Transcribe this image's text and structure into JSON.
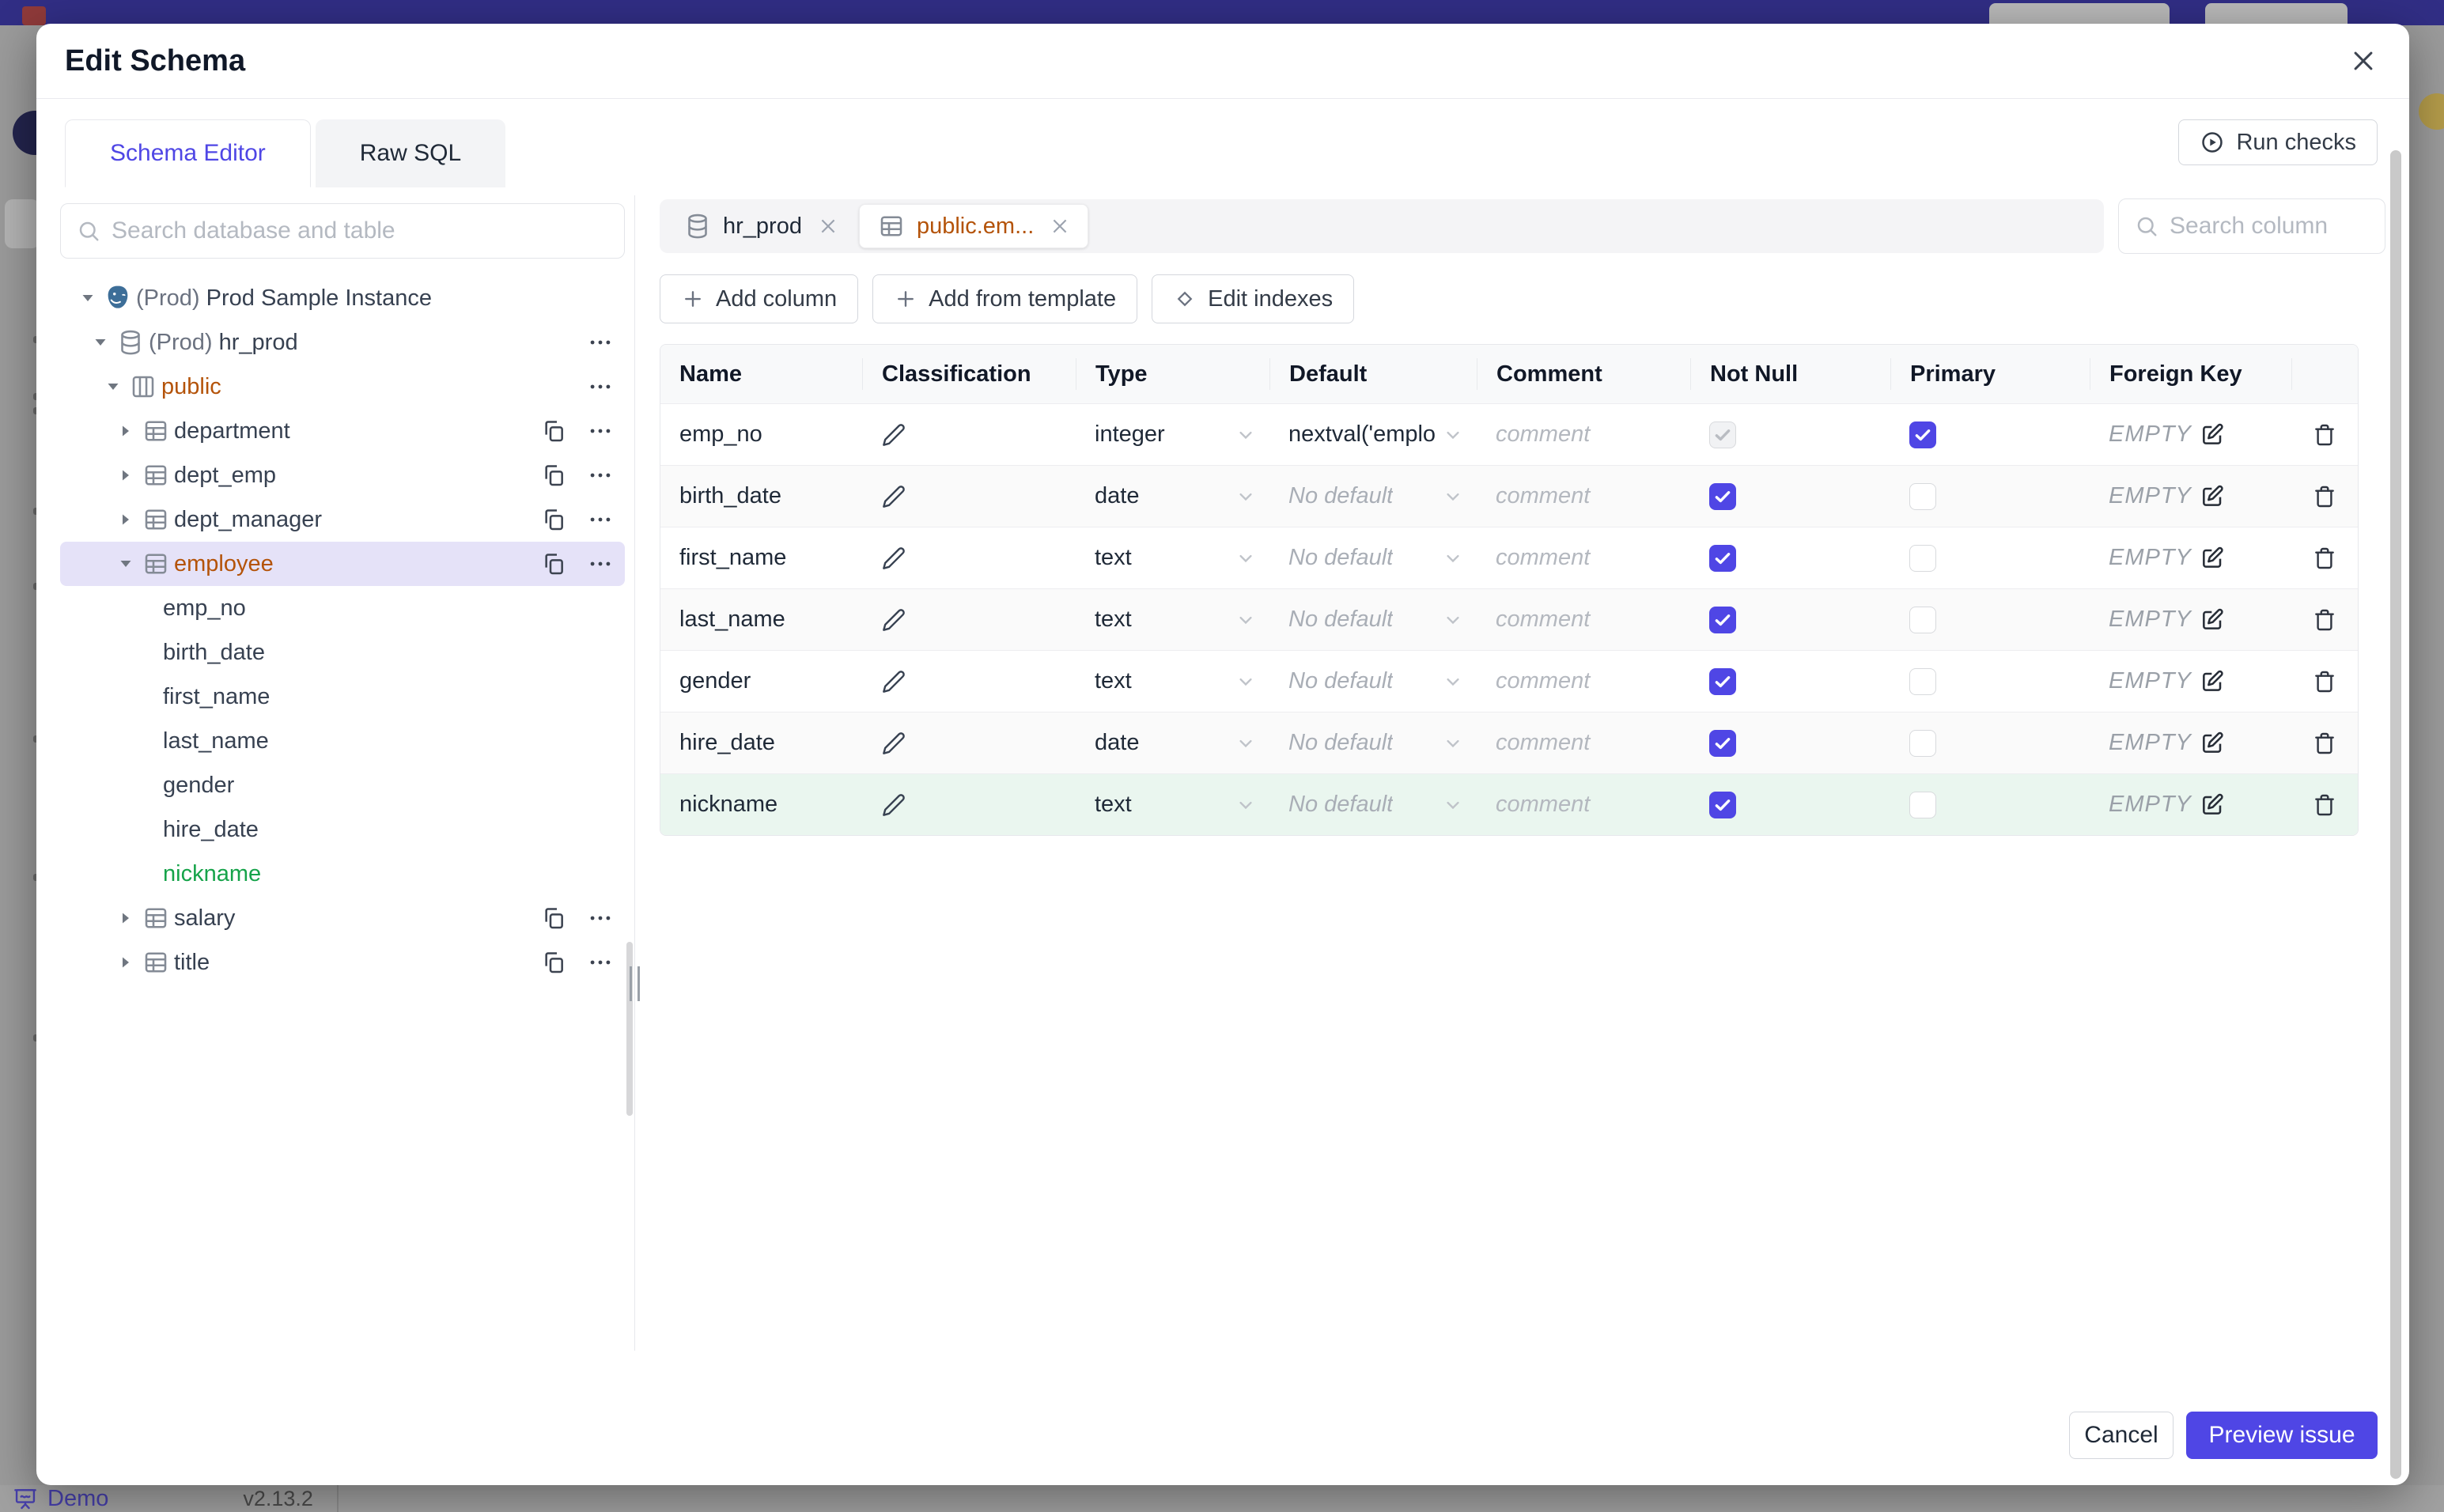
{
  "backdrop": {
    "demo_label": "Demo",
    "version": "v2.13.2"
  },
  "modal": {
    "title": "Edit Schema",
    "close_icon": "close",
    "tabs": [
      {
        "label": "Schema Editor",
        "active": true
      },
      {
        "label": "Raw SQL",
        "active": false
      }
    ],
    "run_checks_label": "Run checks",
    "sidebar": {
      "search_placeholder": "Search database and table",
      "tree": [
        {
          "level": 0,
          "caret": "down",
          "icon": "postgres",
          "prefix": "(Prod) ",
          "label": "Prod Sample Instance"
        },
        {
          "level": 1,
          "caret": "down",
          "icon": "database",
          "prefix": "(Prod) ",
          "label": "hr_prod",
          "menu": true
        },
        {
          "level": 2,
          "caret": "down",
          "icon": "schema",
          "label": "public",
          "color": "amber",
          "menu": true
        },
        {
          "level": 3,
          "caret": "right",
          "icon": "table",
          "label": "department",
          "copy": true,
          "menu": true
        },
        {
          "level": 3,
          "caret": "right",
          "icon": "table",
          "label": "dept_emp",
          "copy": true,
          "menu": true
        },
        {
          "level": 3,
          "caret": "right",
          "icon": "table",
          "label": "dept_manager",
          "copy": true,
          "menu": true
        },
        {
          "level": 3,
          "caret": "down",
          "icon": "table",
          "label": "employee",
          "color": "amber",
          "selected": true,
          "copy": true,
          "menu": true
        },
        {
          "level": 4,
          "label": "emp_no"
        },
        {
          "level": 4,
          "label": "birth_date"
        },
        {
          "level": 4,
          "label": "first_name"
        },
        {
          "level": 4,
          "label": "last_name"
        },
        {
          "level": 4,
          "label": "gender"
        },
        {
          "level": 4,
          "label": "hire_date"
        },
        {
          "level": 4,
          "label": "nickname",
          "color": "green"
        },
        {
          "level": 3,
          "caret": "right",
          "icon": "table",
          "label": "salary",
          "copy": true,
          "menu": true
        },
        {
          "level": 3,
          "caret": "right",
          "icon": "table",
          "label": "title",
          "copy": true,
          "menu": true
        }
      ]
    },
    "main": {
      "chips": [
        {
          "label": "hr_prod",
          "icon": "database",
          "selected": false
        },
        {
          "label": "public.em...",
          "icon": "table",
          "selected": true
        }
      ],
      "search_column_placeholder": "Search column",
      "actions": [
        {
          "label": "Add column",
          "icon": "plus"
        },
        {
          "label": "Add from template",
          "icon": "plus"
        },
        {
          "label": "Edit indexes",
          "icon": "diamond"
        }
      ],
      "table": {
        "headers": [
          "Name",
          "Classification",
          "Type",
          "Default",
          "Comment",
          "Not Null",
          "Primary",
          "Foreign Key",
          ""
        ],
        "comment_placeholder": "comment",
        "foreign_key_empty": "EMPTY",
        "rows": [
          {
            "name": "emp_no",
            "type": "integer",
            "default": "nextval('employ",
            "default_placeholder": false,
            "not_null": true,
            "not_null_disabled": true,
            "primary": true,
            "new": false
          },
          {
            "name": "birth_date",
            "type": "date",
            "default": "No default",
            "default_placeholder": true,
            "not_null": true,
            "not_null_disabled": false,
            "primary": false,
            "new": false
          },
          {
            "name": "first_name",
            "type": "text",
            "default": "No default",
            "default_placeholder": true,
            "not_null": true,
            "not_null_disabled": false,
            "primary": false,
            "new": false
          },
          {
            "name": "last_name",
            "type": "text",
            "default": "No default",
            "default_placeholder": true,
            "not_null": true,
            "not_null_disabled": false,
            "primary": false,
            "new": false
          },
          {
            "name": "gender",
            "type": "text",
            "default": "No default",
            "default_placeholder": true,
            "not_null": true,
            "not_null_disabled": false,
            "primary": false,
            "new": false
          },
          {
            "name": "hire_date",
            "type": "date",
            "default": "No default",
            "default_placeholder": true,
            "not_null": true,
            "not_null_disabled": false,
            "primary": false,
            "new": false
          },
          {
            "name": "nickname",
            "type": "text",
            "default": "No default",
            "default_placeholder": true,
            "not_null": true,
            "not_null_disabled": false,
            "primary": false,
            "new": true
          }
        ]
      }
    },
    "footer": {
      "cancel": "Cancel",
      "primary": "Preview issue"
    }
  },
  "colors": {
    "accent": "#4f46e5",
    "amber": "#b45309",
    "green": "#16a34a",
    "topbar": "#312e85",
    "selected_row": "#e5e2f8",
    "new_row": "#eaf6ef"
  }
}
